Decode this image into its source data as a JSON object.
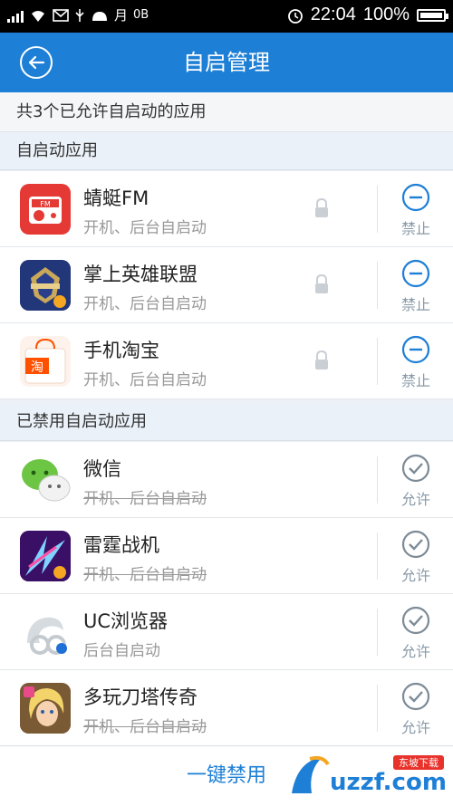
{
  "status_bar": {
    "time": "22:04",
    "battery": "100%",
    "moon_text": "月",
    "data_text": "0B"
  },
  "header": {
    "title": "自启管理"
  },
  "summary": "共3个已允许自启动的应用",
  "sections": {
    "enabled": "自启动应用",
    "disabled": "已禁用自启动应用"
  },
  "enabled_apps": [
    {
      "name": "蜻蜓FM",
      "desc": "开机、后台自启动",
      "action": "禁止",
      "icon_text": "FM"
    },
    {
      "name": "掌上英雄联盟",
      "desc": "开机、后台自启动",
      "action": "禁止",
      "icon_text": ""
    },
    {
      "name": "手机淘宝",
      "desc": "开机、后台自启动",
      "action": "禁止",
      "icon_text": "淘"
    }
  ],
  "disabled_apps": [
    {
      "name": "微信",
      "desc": "开机、后台自启动",
      "action": "允许"
    },
    {
      "name": "雷霆战机",
      "desc": "开机、后台自启动",
      "action": "允许"
    },
    {
      "name": "UC浏览器",
      "desc": "后台自启动",
      "action": "允许"
    },
    {
      "name": "多玩刀塔传奇",
      "desc": "开机、后台自启动",
      "action": "允许"
    }
  ],
  "bottom_button": "一键禁用",
  "watermark": {
    "domain": "uzzf.com",
    "tag": "东坡下载"
  },
  "colors": {
    "primary": "#1e7fd6",
    "background": "#edf1f5",
    "action_gray": "#8a9aa8"
  }
}
